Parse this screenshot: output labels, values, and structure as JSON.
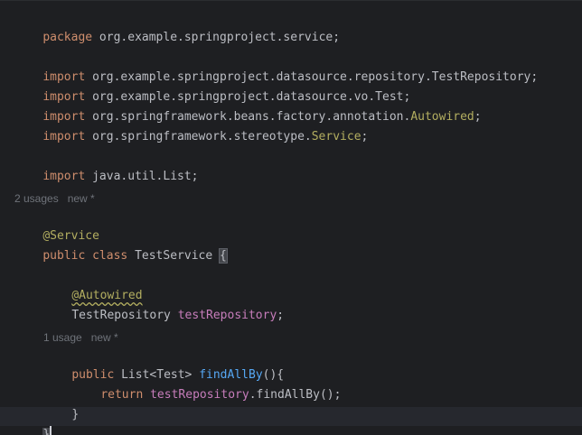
{
  "editor": {
    "lines": {
      "package_kw": "package",
      "package_name": " org.example.springproject.service;",
      "import_kw": "import",
      "import1": " org.example.springproject.datasource.repository.TestRepository;",
      "import2": " org.example.springproject.datasource.vo.Test;",
      "import3_pre": " org.springframework.beans.factory.annotation.",
      "import3_ann": "Autowired",
      "import3_post": ";",
      "import4_pre": " org.springframework.stereotype.",
      "import4_ann": "Service",
      "import4_post": ";",
      "import5": " java.util.List;",
      "class_usages_hint": "2 usages   new *",
      "service_annotation": "@Service",
      "class_public": "public",
      "class_kw": " class",
      "class_name": " TestService ",
      "open_brace": "{",
      "autowired_annotation": "@Autowired",
      "field_type": "TestRepository ",
      "field_name": "testRepository",
      "semicolon": ";",
      "method_usages_hint": "1 usage   new *",
      "method_public": "public",
      "method_return_type": " List<Test> ",
      "method_name": "findAllBy",
      "method_sig_end": "(){",
      "return_kw": "return",
      "return_field": "testRepository",
      "return_call": ".findAllBy();",
      "method_close": "}",
      "class_close": "}"
    },
    "colors": {
      "background": "#1e1f22",
      "keyword": "#cf8e6d",
      "annotation": "#b3ae60",
      "field": "#c77dbb",
      "method": "#56a8f5",
      "text": "#bcbec4",
      "hint": "#6f737a"
    }
  }
}
